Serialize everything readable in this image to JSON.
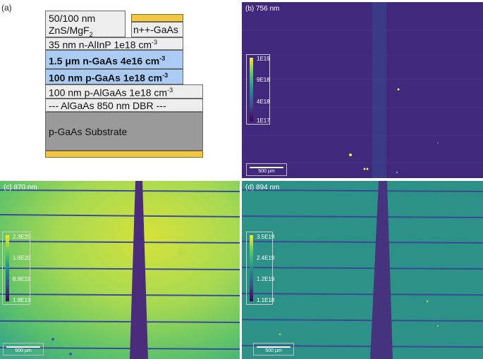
{
  "panel_a": {
    "letter": "(a)",
    "layers": {
      "znsmgf2": {
        "line1": "50/100 nm",
        "line2_prefix": "ZnS/MgF",
        "line2_sub": "2"
      },
      "contact": "n++-GaAs",
      "alinp": {
        "text": "35 nm  n-AlInP  1e18 cm",
        "sup": "-3"
      },
      "ngaas": {
        "text": "1.5 μm  n-GaAs  4e16 cm",
        "sup": "-3"
      },
      "pgaas": {
        "text": "100 nm  p-GaAs  1e18 cm",
        "sup": "-3"
      },
      "palgaas": {
        "text": "100 nm  p-AlGaAs  1e18 cm",
        "sup": "-3"
      },
      "dbr": "--- AlGaAs 850 nm DBR ---",
      "substrate": "p-GaAs Substrate"
    },
    "colors": {
      "blue": "#a9cbf4",
      "gray": "#ededed",
      "substrate": "#9a9a9a",
      "gold": "#f2c744"
    }
  },
  "panel_b": {
    "label": "(b) 756 nm",
    "colorbar": [
      "1E19",
      "9E18",
      "4E18",
      "1E17"
    ],
    "scalebar": "500 µm"
  },
  "panel_c": {
    "label": "(c) 870 nm",
    "colorbar": [
      "2.3E20",
      "1.6E20",
      "8.9E19",
      "1.8E19"
    ],
    "scalebar": "500 µm"
  },
  "panel_d": {
    "label": "(d) 894 nm",
    "colorbar": [
      "3.5E19",
      "2.4E19",
      "1.2E19",
      "1.1E18"
    ],
    "scalebar": "500 µm"
  }
}
